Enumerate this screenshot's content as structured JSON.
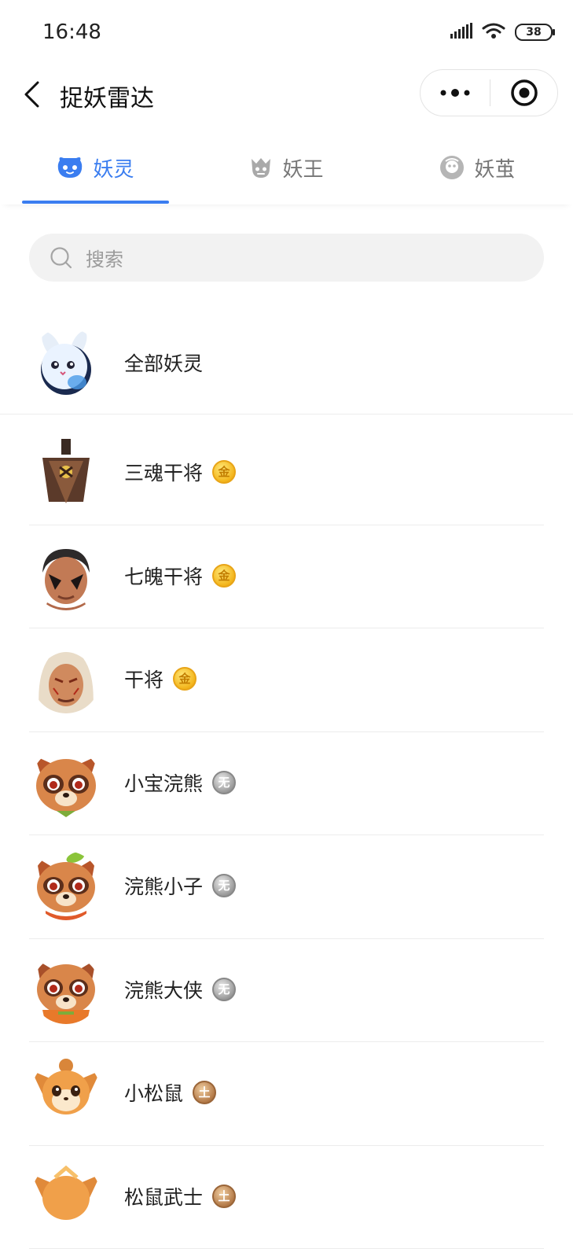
{
  "status_bar": {
    "time": "16:48",
    "battery": "38"
  },
  "nav": {
    "title": "捉妖雷达"
  },
  "tabs": [
    {
      "label": "妖灵",
      "active": true
    },
    {
      "label": "妖王",
      "active": false
    },
    {
      "label": "妖茧",
      "active": false
    }
  ],
  "search": {
    "placeholder": "搜索"
  },
  "all_row": {
    "label": "全部妖灵"
  },
  "items": [
    {
      "name": "三魂干将",
      "badge": "金",
      "badge_type": "gold"
    },
    {
      "name": "七魄干将",
      "badge": "金",
      "badge_type": "gold"
    },
    {
      "name": "干将",
      "badge": "金",
      "badge_type": "gold"
    },
    {
      "name": "小宝浣熊",
      "badge": "无",
      "badge_type": "silver"
    },
    {
      "name": "浣熊小子",
      "badge": "无",
      "badge_type": "silver"
    },
    {
      "name": "浣熊大侠",
      "badge": "无",
      "badge_type": "silver"
    },
    {
      "name": "小松鼠",
      "badge": "土",
      "badge_type": "bronze"
    },
    {
      "name": "松鼠武士",
      "badge": "土",
      "badge_type": "bronze"
    }
  ],
  "colors": {
    "accent": "#3a7df0",
    "gold_badge": "#f3b51c",
    "silver_badge": "#9a9a9a",
    "bronze_badge": "#b47a48"
  }
}
